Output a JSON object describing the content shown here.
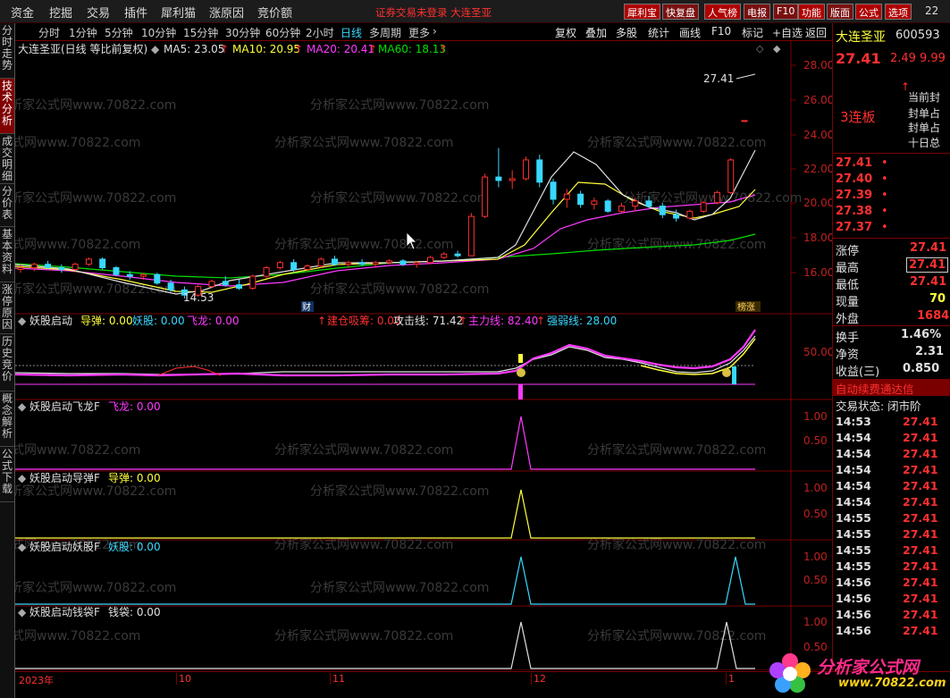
{
  "menu": {
    "items": [
      "资金",
      "挖掘",
      "交易",
      "插件",
      "犀利猫",
      "涨原因",
      "竞价额"
    ],
    "notice": "证券交易未登录  大连圣亚",
    "right_buttons": [
      "犀利宝",
      "快复盘",
      "人气榜",
      "电报",
      "F10",
      "功能",
      "版面",
      "公式",
      "选项"
    ],
    "right_number": "22"
  },
  "left_tabs": [
    "分时走势",
    "技术分析",
    "成交明细",
    "分价表",
    "基本资料",
    "涨停原因",
    "历史竞价",
    "概念解析",
    "公式下载"
  ],
  "period_bar": {
    "periods": [
      "分时",
      "1分钟",
      "5分钟",
      "10分钟",
      "15分钟",
      "30分钟",
      "60分钟",
      "2小时",
      "日线",
      "多周期",
      "更多"
    ],
    "selected": "日线",
    "right_tools": [
      "复权",
      "叠加",
      "多股",
      "统计",
      "画线",
      "F10",
      "标记",
      "+自选",
      "返回"
    ]
  },
  "main_panel": {
    "title": "大连圣亚(日线 等比前复权)",
    "ma": [
      {
        "label": "MA5: 23.05",
        "color": "#e0e0e0"
      },
      {
        "label": "MA10: 20.95",
        "color": "#ffff3a"
      },
      {
        "label": "MA20: 20.41",
        "color": "#ff3aff"
      },
      {
        "label": "MA60: 18.13",
        "color": "#00e000"
      }
    ],
    "high_label": "27.41",
    "low_label": "14.53",
    "marker_cai": "财",
    "marker_tag": "榜涨",
    "y_ticks": [
      "28.00",
      "26.00",
      "24.00",
      "22.00",
      "20.00",
      "18.00",
      "16.00"
    ]
  },
  "watermark": "分析家公式网www.70822.com",
  "indicator1": {
    "title": "妖股启动",
    "values": [
      {
        "label": "导弹: 0.00",
        "color": "#ffff3a"
      },
      {
        "label": "妖股: 0.00",
        "color": "#38d8ff"
      },
      {
        "label": "飞龙: 0.00",
        "color": "#ff3aff"
      },
      {
        "label": "建仓吸筹: 0.00",
        "color": "#ff3030"
      },
      {
        "label": "攻击线: 71.42",
        "color": "#e0e0e0"
      },
      {
        "label": "主力线: 82.40",
        "color": "#ff3aff"
      },
      {
        "label": "强弱线: 28.00",
        "color": "#38d8ff"
      }
    ],
    "y_tick": "50.00"
  },
  "indicator2": {
    "title": "妖股启动飞龙F",
    "value": "飞龙: 0.00",
    "y_ticks": [
      "1.00",
      "0.50"
    ]
  },
  "indicator3": {
    "title": "妖股启动导弹F",
    "value": "导弹: 0.00",
    "y_ticks": [
      "1.00",
      "0.50"
    ]
  },
  "indicator4": {
    "title": "妖股启动妖股F",
    "value": "妖股: 0.00",
    "y_ticks": [
      "1.00",
      "0.50"
    ]
  },
  "indicator5": {
    "title": "妖股启动钱袋F",
    "value": "钱袋: 0.00",
    "y_ticks": [
      "1.00",
      "0.50"
    ]
  },
  "x_axis": [
    "2023年",
    "10",
    "11",
    "12",
    "1"
  ],
  "quote": {
    "name": "大连圣亚",
    "code": "600593",
    "price": "27.41",
    "change": "2.49",
    "pct": "9.99",
    "streak": "3连板",
    "side_labels": [
      "当前封",
      "封单占",
      "封单占",
      "十日总"
    ],
    "order_book": [
      "27.41",
      "27.40",
      "27.39",
      "27.38",
      "27.37"
    ],
    "stats": [
      {
        "label": "涨停",
        "value": "27.41",
        "color": "#ff3030",
        "boxed": false
      },
      {
        "label": "最高",
        "value": "27.41",
        "color": "#ff3030",
        "boxed": true
      },
      {
        "label": "最低",
        "value": "27.41",
        "color": "#ff3030",
        "boxed": false
      },
      {
        "label": "现量",
        "value": "70",
        "color": "#ffff3a",
        "boxed": false
      },
      {
        "label": "外盘",
        "value": "1684",
        "color": "#ff3030",
        "boxed": false
      },
      {
        "label": "换手",
        "value": "1.46%",
        "color": "#e0e0e0",
        "boxed": false
      },
      {
        "label": "净资",
        "value": "2.31",
        "color": "#e0e0e0",
        "boxed": false
      },
      {
        "label": "收益(三)",
        "value": "0.850",
        "color": "#e0e0e0",
        "boxed": false
      }
    ],
    "banner": "自动续费通达信",
    "status": "交易状态: 闭市阶",
    "trades": [
      {
        "time": "14:53",
        "price": "27.41"
      },
      {
        "time": "14:54",
        "price": "27.41"
      },
      {
        "time": "14:54",
        "price": "27.41"
      },
      {
        "time": "14:54",
        "price": "27.41"
      },
      {
        "time": "14:54",
        "price": "27.41"
      },
      {
        "time": "14:54",
        "price": "27.41"
      },
      {
        "time": "14:55",
        "price": "27.41"
      },
      {
        "time": "14:55",
        "price": "27.41"
      },
      {
        "time": "14:55",
        "price": "27.41"
      },
      {
        "time": "14:55",
        "price": "27.41"
      },
      {
        "time": "14:56",
        "price": "27.41"
      },
      {
        "time": "14:56",
        "price": "27.41"
      },
      {
        "time": "14:56",
        "price": "27.41"
      },
      {
        "time": "14:56",
        "price": "27.41"
      }
    ]
  },
  "logo": {
    "title": "分析家公式网",
    "url": "www.70822.com"
  },
  "colors": {
    "up": "#ff3030",
    "down": "#38d8ff",
    "ma5": "#e0e0e0",
    "ma10": "#ffff3a",
    "ma20": "#ff3aff",
    "ma60": "#00e000",
    "grid": "#7a0000"
  },
  "chart_data": {
    "type": "candlestick",
    "price_range": [
      14.5,
      28.5
    ],
    "candles": [
      [
        16.2,
        16.5,
        16.0,
        16.3
      ],
      [
        16.3,
        16.6,
        16.1,
        16.5
      ],
      [
        16.5,
        16.7,
        16.2,
        16.3
      ],
      [
        16.3,
        16.5,
        16.0,
        16.2
      ],
      [
        16.2,
        16.6,
        16.1,
        16.5
      ],
      [
        16.5,
        16.9,
        16.4,
        16.8
      ],
      [
        16.8,
        16.9,
        16.2,
        16.3
      ],
      [
        16.3,
        16.4,
        15.8,
        15.9
      ],
      [
        15.9,
        16.1,
        15.6,
        15.8
      ],
      [
        15.8,
        16.0,
        15.6,
        15.9
      ],
      [
        15.9,
        16.0,
        15.3,
        15.4
      ],
      [
        15.4,
        15.6,
        14.9,
        15.0
      ],
      [
        15.0,
        15.2,
        14.5,
        14.7
      ],
      [
        14.7,
        15.3,
        14.6,
        15.2
      ],
      [
        15.2,
        15.6,
        15.1,
        15.5
      ],
      [
        15.5,
        15.8,
        15.2,
        15.3
      ],
      [
        15.3,
        15.6,
        15.0,
        15.1
      ],
      [
        15.1,
        15.9,
        15.0,
        15.8
      ],
      [
        15.8,
        16.4,
        15.7,
        16.3
      ],
      [
        16.3,
        16.7,
        16.2,
        16.6
      ],
      [
        16.6,
        16.8,
        16.0,
        16.2
      ],
      [
        16.2,
        16.5,
        16.1,
        16.4
      ],
      [
        16.4,
        16.9,
        16.3,
        16.8
      ],
      [
        16.8,
        17.0,
        16.4,
        16.5
      ],
      [
        16.5,
        16.7,
        16.3,
        16.6
      ],
      [
        16.6,
        16.8,
        16.4,
        16.5
      ],
      [
        16.5,
        16.7,
        16.3,
        16.6
      ],
      [
        16.6,
        16.8,
        16.5,
        16.7
      ],
      [
        16.7,
        16.8,
        16.4,
        16.5
      ],
      [
        16.5,
        16.7,
        16.3,
        16.6
      ],
      [
        16.6,
        17.0,
        16.5,
        16.9
      ],
      [
        16.9,
        17.2,
        16.8,
        17.1
      ],
      [
        17.1,
        17.3,
        16.9,
        17.0
      ],
      [
        17.0,
        19.5,
        17.0,
        19.3
      ],
      [
        19.3,
        21.8,
        19.2,
        21.6
      ],
      [
        21.6,
        23.3,
        21.0,
        21.4
      ],
      [
        21.4,
        22.0,
        20.9,
        21.5
      ],
      [
        21.5,
        22.8,
        21.4,
        22.6
      ],
      [
        22.6,
        22.9,
        21.0,
        21.3
      ],
      [
        21.3,
        21.5,
        20.0,
        20.3
      ],
      [
        20.3,
        20.9,
        19.8,
        20.6
      ],
      [
        20.6,
        20.8,
        19.8,
        20.0
      ],
      [
        20.0,
        20.4,
        19.7,
        20.2
      ],
      [
        20.2,
        20.3,
        19.5,
        19.6
      ],
      [
        19.6,
        20.1,
        19.5,
        19.9
      ],
      [
        19.9,
        20.4,
        19.6,
        20.2
      ],
      [
        20.2,
        20.5,
        19.8,
        19.9
      ],
      [
        19.9,
        20.1,
        19.2,
        19.4
      ],
      [
        19.4,
        19.7,
        19.0,
        19.2
      ],
      [
        19.2,
        19.7,
        19.1,
        19.6
      ],
      [
        19.6,
        20.2,
        19.5,
        20.1
      ],
      [
        20.1,
        20.8,
        20.0,
        20.7
      ],
      [
        20.7,
        22.7,
        20.6,
        22.6
      ],
      [
        24.9,
        24.9,
        24.9,
        24.9
      ]
    ]
  }
}
